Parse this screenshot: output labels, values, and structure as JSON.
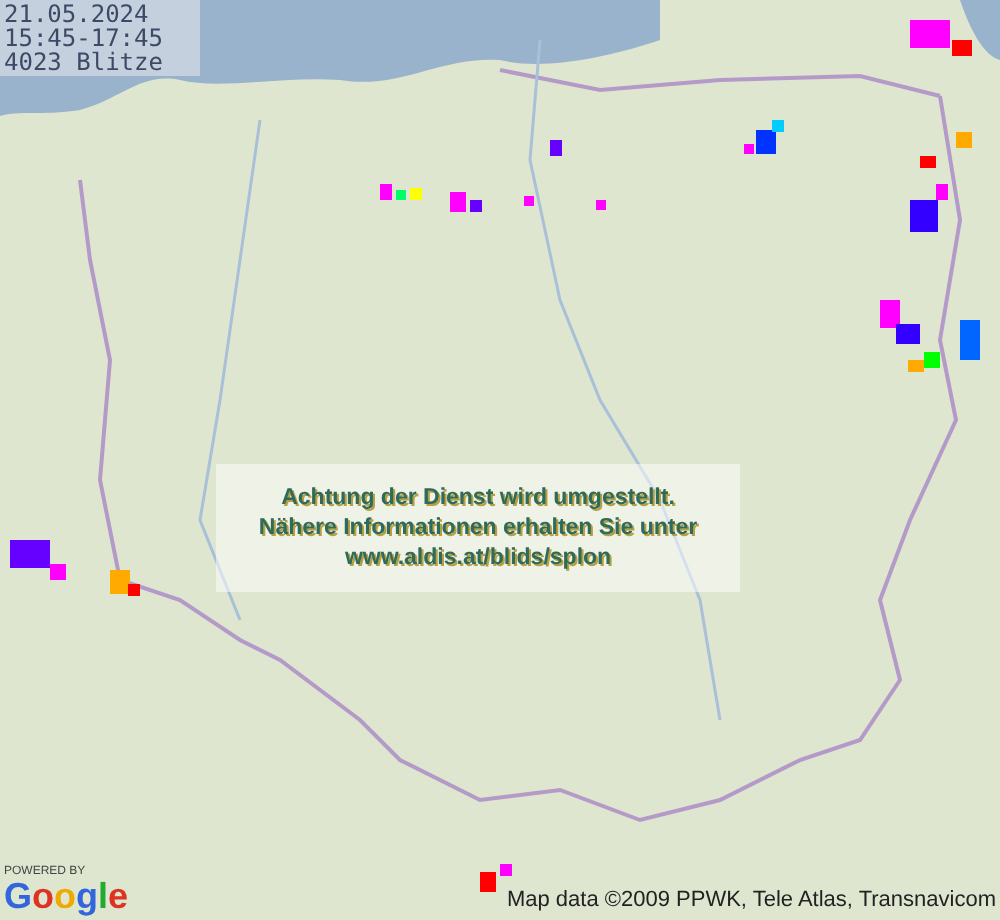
{
  "info_box": {
    "date": "21.05.2024",
    "time_range": "15:45-17:45",
    "count": "4023 Blitze"
  },
  "notice": {
    "lines": [
      "Achtung der Dienst wird umgestellt.",
      "Nähere Informationen erhalten Sie unter",
      "www.aldis.at/blids/splon"
    ]
  },
  "attribution": {
    "powered_by": "POWERED BY",
    "logo": "Google",
    "map_data": "Map data ©2009 PPWK, Tele Atlas, Transnavicom"
  }
}
